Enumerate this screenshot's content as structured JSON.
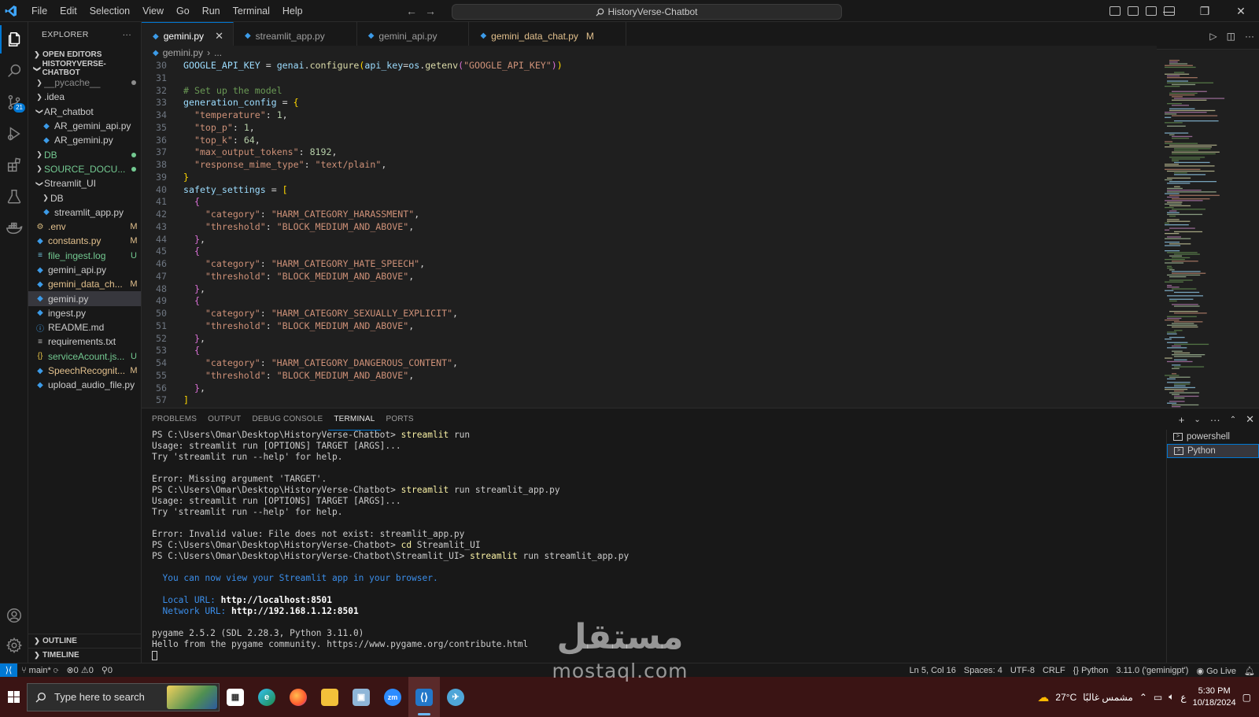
{
  "titlebar": {
    "menu": [
      "File",
      "Edit",
      "Selection",
      "View",
      "Go",
      "Run",
      "Terminal",
      "Help"
    ],
    "search_text": "HistoryVerse-Chatbot"
  },
  "activity_bar": {
    "items": [
      "explorer-icon",
      "search-icon",
      "source-control-icon",
      "run-debug-icon",
      "extensions-icon",
      "testing-icon",
      "docker-icon"
    ],
    "scm_badge": "21"
  },
  "sidebar": {
    "header": "EXPLORER",
    "open_editors": "OPEN EDITORS",
    "project": "HISTORYVERSE-CHATBOT",
    "tree": [
      {
        "name": "__pycache__",
        "type": "folder",
        "depth": 0,
        "status": "dot-gray"
      },
      {
        "name": ".idea",
        "type": "folder",
        "depth": 0,
        "status": ""
      },
      {
        "name": "AR_chatbot",
        "type": "folder-open",
        "depth": 0,
        "status": ""
      },
      {
        "name": "AR_gemini_api.py",
        "type": "py",
        "depth": 1,
        "status": ""
      },
      {
        "name": "AR_gemini.py",
        "type": "py",
        "depth": 1,
        "status": ""
      },
      {
        "name": "DB",
        "type": "folder",
        "depth": 0,
        "status": "dot-green"
      },
      {
        "name": "SOURCE_DOCU...",
        "type": "folder",
        "depth": 0,
        "status": "dot-green"
      },
      {
        "name": "Streamlit_UI",
        "type": "folder-open",
        "depth": 0,
        "status": ""
      },
      {
        "name": "DB",
        "type": "folder",
        "depth": 1,
        "status": ""
      },
      {
        "name": "streamlit_app.py",
        "type": "py",
        "depth": 1,
        "status": ""
      },
      {
        "name": ".env",
        "type": "env",
        "depth": 0,
        "status": "M"
      },
      {
        "name": "constants.py",
        "type": "py",
        "depth": 0,
        "status": "M"
      },
      {
        "name": "file_ingest.log",
        "type": "log",
        "depth": 0,
        "status": "U"
      },
      {
        "name": "gemini_api.py",
        "type": "py",
        "depth": 0,
        "status": ""
      },
      {
        "name": "gemini_data_ch...",
        "type": "py",
        "depth": 0,
        "status": "M"
      },
      {
        "name": "gemini.py",
        "type": "py",
        "depth": 0,
        "status": "",
        "selected": true
      },
      {
        "name": "ingest.py",
        "type": "py",
        "depth": 0,
        "status": ""
      },
      {
        "name": "README.md",
        "type": "md",
        "depth": 0,
        "status": ""
      },
      {
        "name": "requirements.txt",
        "type": "txt",
        "depth": 0,
        "status": ""
      },
      {
        "name": "serviceAcount.js...",
        "type": "json",
        "depth": 0,
        "status": "U"
      },
      {
        "name": "SpeechRecognit...",
        "type": "py",
        "depth": 0,
        "status": "M"
      },
      {
        "name": "upload_audio_file.py",
        "type": "py",
        "depth": 0,
        "status": ""
      }
    ],
    "outline": "OUTLINE",
    "timeline": "TIMELINE"
  },
  "tabs": [
    {
      "label": "gemini.py",
      "active": true,
      "modified": false
    },
    {
      "label": "streamlit_app.py",
      "active": false,
      "modified": false
    },
    {
      "label": "gemini_api.py",
      "active": false,
      "modified": false
    },
    {
      "label": "gemini_data_chat.py",
      "active": false,
      "modified": true
    }
  ],
  "breadcrumb": [
    "gemini.py",
    "..."
  ],
  "editor": {
    "lines": [
      {
        "n": "30",
        "code": "GOOGLE_API_KEY = genai.configure(api_key=os.getenv(\"GOOGLE_API_KEY\"))"
      },
      {
        "n": "31",
        "code": ""
      },
      {
        "n": "32",
        "code": "# Set up the model"
      },
      {
        "n": "33",
        "code": "generation_config = {"
      },
      {
        "n": "34",
        "code": "  \"temperature\": 1,"
      },
      {
        "n": "35",
        "code": "  \"top_p\": 1,"
      },
      {
        "n": "36",
        "code": "  \"top_k\": 64,"
      },
      {
        "n": "37",
        "code": "  \"max_output_tokens\": 8192,"
      },
      {
        "n": "38",
        "code": "  \"response_mime_type\": \"text/plain\","
      },
      {
        "n": "39",
        "code": "}"
      },
      {
        "n": "40",
        "code": "safety_settings = ["
      },
      {
        "n": "41",
        "code": "  {"
      },
      {
        "n": "42",
        "code": "    \"category\": \"HARM_CATEGORY_HARASSMENT\","
      },
      {
        "n": "43",
        "code": "    \"threshold\": \"BLOCK_MEDIUM_AND_ABOVE\","
      },
      {
        "n": "44",
        "code": "  },"
      },
      {
        "n": "45",
        "code": "  {"
      },
      {
        "n": "46",
        "code": "    \"category\": \"HARM_CATEGORY_HATE_SPEECH\","
      },
      {
        "n": "47",
        "code": "    \"threshold\": \"BLOCK_MEDIUM_AND_ABOVE\","
      },
      {
        "n": "48",
        "code": "  },"
      },
      {
        "n": "49",
        "code": "  {"
      },
      {
        "n": "50",
        "code": "    \"category\": \"HARM_CATEGORY_SEXUALLY_EXPLICIT\","
      },
      {
        "n": "51",
        "code": "    \"threshold\": \"BLOCK_MEDIUM_AND_ABOVE\","
      },
      {
        "n": "52",
        "code": "  },"
      },
      {
        "n": "53",
        "code": "  {"
      },
      {
        "n": "54",
        "code": "    \"category\": \"HARM_CATEGORY_DANGEROUS_CONTENT\","
      },
      {
        "n": "55",
        "code": "    \"threshold\": \"BLOCK_MEDIUM_AND_ABOVE\","
      },
      {
        "n": "56",
        "code": "  },"
      },
      {
        "n": "57",
        "code": "]"
      }
    ]
  },
  "panel": {
    "tabs": [
      "PROBLEMS",
      "OUTPUT",
      "DEBUG CONSOLE",
      "TERMINAL",
      "PORTS"
    ],
    "active_tab": "TERMINAL",
    "terminal_lines": [
      {
        "kind": "prompt",
        "prompt": "PS C:\\Users\\Omar\\Desktop\\HistoryVerse-Chatbot> ",
        "cmd": "streamlit",
        "args": " run"
      },
      {
        "kind": "plain",
        "text": "Usage: streamlit run [OPTIONS] TARGET [ARGS]..."
      },
      {
        "kind": "plain",
        "text": "Try 'streamlit run --help' for help."
      },
      {
        "kind": "plain",
        "text": ""
      },
      {
        "kind": "plain",
        "text": "Error: Missing argument 'TARGET'."
      },
      {
        "kind": "prompt",
        "prompt": "PS C:\\Users\\Omar\\Desktop\\HistoryVerse-Chatbot> ",
        "cmd": "streamlit",
        "args": " run streamlit_app.py"
      },
      {
        "kind": "plain",
        "text": "Usage: streamlit run [OPTIONS] TARGET [ARGS]..."
      },
      {
        "kind": "plain",
        "text": "Try 'streamlit run --help' for help."
      },
      {
        "kind": "plain",
        "text": ""
      },
      {
        "kind": "plain",
        "text": "Error: Invalid value: File does not exist: streamlit_app.py"
      },
      {
        "kind": "prompt",
        "prompt": "PS C:\\Users\\Omar\\Desktop\\HistoryVerse-Chatbot> ",
        "cmd": "cd",
        "args": " Streamlit_UI"
      },
      {
        "kind": "prompt",
        "prompt": "PS C:\\Users\\Omar\\Desktop\\HistoryVerse-Chatbot\\Streamlit_UI> ",
        "cmd": "streamlit",
        "args": " run streamlit_app.py"
      },
      {
        "kind": "plain",
        "text": ""
      },
      {
        "kind": "info",
        "text": "  You can now view your Streamlit app in your browser."
      },
      {
        "kind": "plain",
        "text": ""
      },
      {
        "kind": "url",
        "label": "  Local URL: ",
        "url": "http://localhost:8501"
      },
      {
        "kind": "url",
        "label": "  Network URL: ",
        "url": "http://192.168.1.12:8501"
      },
      {
        "kind": "plain",
        "text": ""
      },
      {
        "kind": "plain",
        "text": "pygame 2.5.2 (SDL 2.28.3, Python 3.11.0)"
      },
      {
        "kind": "plain",
        "text": "Hello from the pygame community. https://www.pygame.org/contribute.html"
      },
      {
        "kind": "cursor",
        "text": ""
      }
    ],
    "terminals": [
      {
        "label": "powershell",
        "active": false
      },
      {
        "label": "Python",
        "active": true
      }
    ]
  },
  "statusbar": {
    "branch": "main*",
    "errors": "0",
    "warnings": "0",
    "ports": "0",
    "position": "Ln 5, Col 16",
    "spaces": "Spaces: 4",
    "encoding": "UTF-8",
    "eol": "CRLF",
    "language": "Python",
    "interpreter": "3.11.0 ('geminigpt')",
    "golive": "Go Live"
  },
  "taskbar": {
    "search_placeholder": "Type here to search",
    "apps": [
      "task-view",
      "edge",
      "firefox",
      "file-explorer",
      "photos",
      "zoom",
      "vscode",
      "app"
    ],
    "weather": "27°C",
    "weather_text": "مشمس غالبًا",
    "lang": "ع",
    "time": "5:30 PM",
    "date": "10/18/2024"
  },
  "watermark": {
    "arabic": "مستقل",
    "latin": "mostaql.com"
  }
}
